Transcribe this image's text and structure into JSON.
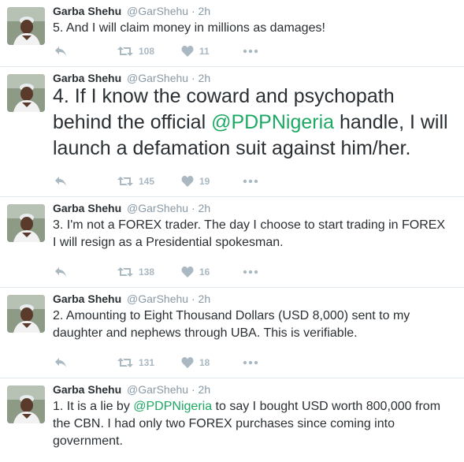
{
  "tweets": [
    {
      "name": "Garba Shehu",
      "handle": "@GarShehu",
      "dot": "·",
      "time": "2h",
      "text_parts": [
        "5. And I will claim money in millions as damages!"
      ],
      "retweets": "108",
      "likes": "11"
    },
    {
      "name": "Garba Shehu",
      "handle": "@GarShehu",
      "dot": "·",
      "time": "2h",
      "text_parts": [
        "4. If I know the coward and psychopath behind the official ",
        "@PDPNigeria",
        " handle, I will launch a defamation suit against him/her."
      ],
      "retweets": "145",
      "likes": "19"
    },
    {
      "name": "Garba Shehu",
      "handle": "@GarShehu",
      "dot": "·",
      "time": "2h",
      "text_parts": [
        "3. I'm not a FOREX trader. The day I choose to start trading in FOREX I will resign as a Presidential spokesman."
      ],
      "retweets": "138",
      "likes": "16"
    },
    {
      "name": "Garba Shehu",
      "handle": "@GarShehu",
      "dot": "·",
      "time": "2h",
      "text_parts": [
        "2. Amounting to Eight Thousand Dollars (USD 8,000) sent to  my daughter and nephews through UBA. This is verifiable."
      ],
      "retweets": "131",
      "likes": "18"
    },
    {
      "name": "Garba Shehu",
      "handle": "@GarShehu",
      "dot": "·",
      "time": "2h",
      "text_parts": [
        "1. It is a lie by ",
        "@PDPNigeria",
        " to say I bought USD worth 800,000 from the CBN. I had only two FOREX purchases since coming into government."
      ]
    }
  ],
  "icons": {
    "reply": "reply-icon",
    "retweet": "retweet-icon",
    "like": "heart-icon",
    "more": "more-icon"
  },
  "colors": {
    "mention": "#1da963",
    "meta": "#8899a6",
    "action": "#aab8c2",
    "divider": "#e1e8ed"
  }
}
